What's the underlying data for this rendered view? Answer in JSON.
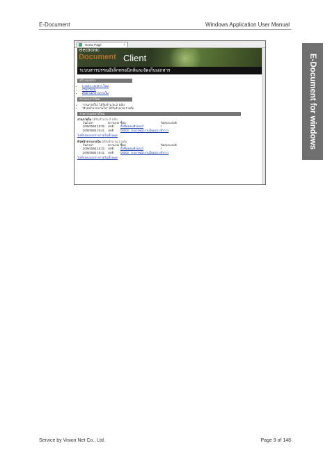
{
  "header": {
    "left": "E-Document",
    "right": "Windows Application User Manual"
  },
  "side_tab": "E-Document for windows",
  "screenshot": {
    "tab_label": "Home Page",
    "banner": {
      "line1": "electronic",
      "line2": "Document",
      "line3": "Client"
    },
    "subtitle": "ระบบสารบรรณอิเล็กทรอนิกส์และจัดเก็บเอกสาร",
    "sections": [
      {
        "title": "สร้างเอกสาร",
        "items": [
          "บาดส่ง, เอกสาร ใหม่",
          "รายงานใน",
          "ค้นหาเอกสารภายใน"
        ]
      },
      {
        "title": "สรุปเอกสารใหม่",
        "items": [
          "\"งานภายใน\" ได้รับจำนวน 2 ฉบับ",
          "\"หัวหน้าจากภายใน\" ได้รับจำนวน 2 ฉบับ"
        ]
      }
    ],
    "received_title": "รายการเอกสารใหม่",
    "groups": [
      {
        "name": "งานภายใน",
        "count": "ได้รับจำนวน 2 ฉบับ",
        "columns": [
          "วัน/เวลา",
          "ความเร่ง ชื่อย",
          "วัตถุประสงค์"
        ],
        "rows": [
          {
            "date": "20/9/2555 10:32",
            "urgency": "ปกติ",
            "subject": "ตั้งชื่อคอมพิวเตอร์",
            "note": "/"
          },
          {
            "date": "20/9/2555 10:41",
            "urgency": "ปกติ",
            "subject": "00002 : ขอลาพนักงานใหม่ประจำการ",
            "note": "/"
          }
        ],
        "more": "ไปที่กล่องเอกสารภายในทั้งหมด"
      },
      {
        "name": "หัวหน้าจากภายใน",
        "count": "ได้รับจำนวน 2 ฉบับ",
        "columns": [
          "วัน/เวลา",
          "ความเร่ง ชื่อย",
          "วัตถุประสงค์"
        ],
        "rows": [
          {
            "date": "20/9/2555 10:32",
            "urgency": "ปกติ",
            "subject": "ตั้งชื่อคอมพิวเตอร์",
            "note": "/"
          },
          {
            "date": "20/9/2555 10:41",
            "urgency": "ปกติ",
            "subject": "00002 : ขอลาพนักงานใหม่ประจำการ",
            "note": "/"
          }
        ],
        "more": "ไปที่กล่องเอกสารภายในทั้งหมด"
      }
    ]
  },
  "footer": {
    "left": "Service by Vision Net Co., Ltd.",
    "right": "Page 9 of 148"
  }
}
